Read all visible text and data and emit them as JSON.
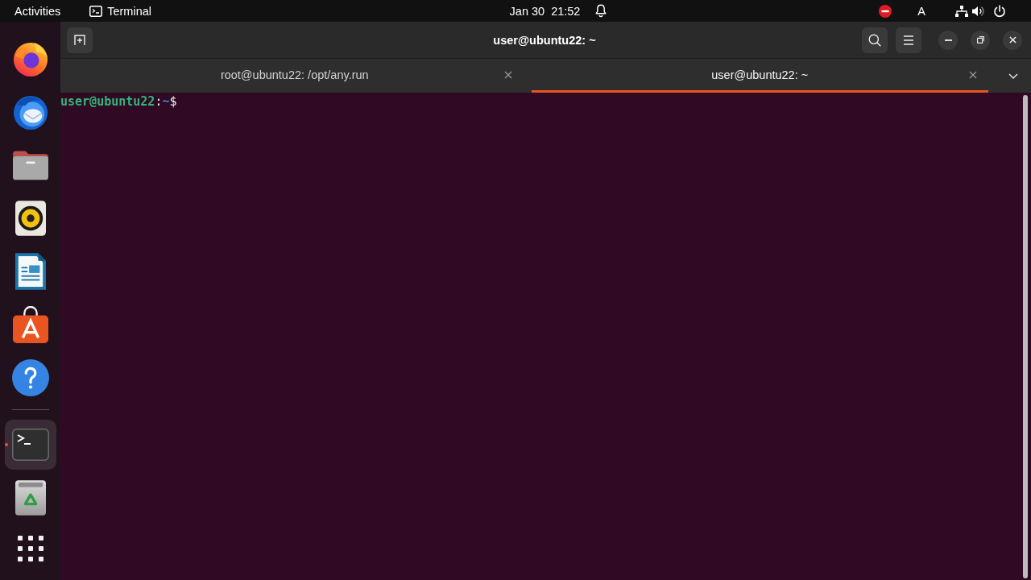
{
  "top_bar": {
    "activities": "Activities",
    "app_menu": "Terminal",
    "clock": {
      "date": "Jan 30",
      "time": "21:52"
    },
    "input_indicator": "A"
  },
  "dock": {
    "pinned": [
      {
        "kind": "browser",
        "active": false
      },
      {
        "kind": "mail",
        "active": false
      },
      {
        "kind": "files",
        "active": false
      },
      {
        "kind": "music",
        "active": false
      },
      {
        "kind": "writer",
        "active": false
      },
      {
        "kind": "store",
        "active": false
      },
      {
        "kind": "help",
        "active": false
      }
    ],
    "others": [
      {
        "kind": "terminal",
        "active": true
      },
      {
        "kind": "trash",
        "active": false
      }
    ]
  },
  "window": {
    "title": "user@ubuntu22: ~"
  },
  "tabs": [
    {
      "label": "root@ubuntu22: /opt/any.run",
      "selected": false
    },
    {
      "label": "user@ubuntu22: ~",
      "selected": true
    }
  ],
  "terminal": {
    "lines": [
      {
        "user_host": "user@ubuntu22",
        "separator": ":",
        "path": "~",
        "symbol": "$"
      }
    ]
  }
}
